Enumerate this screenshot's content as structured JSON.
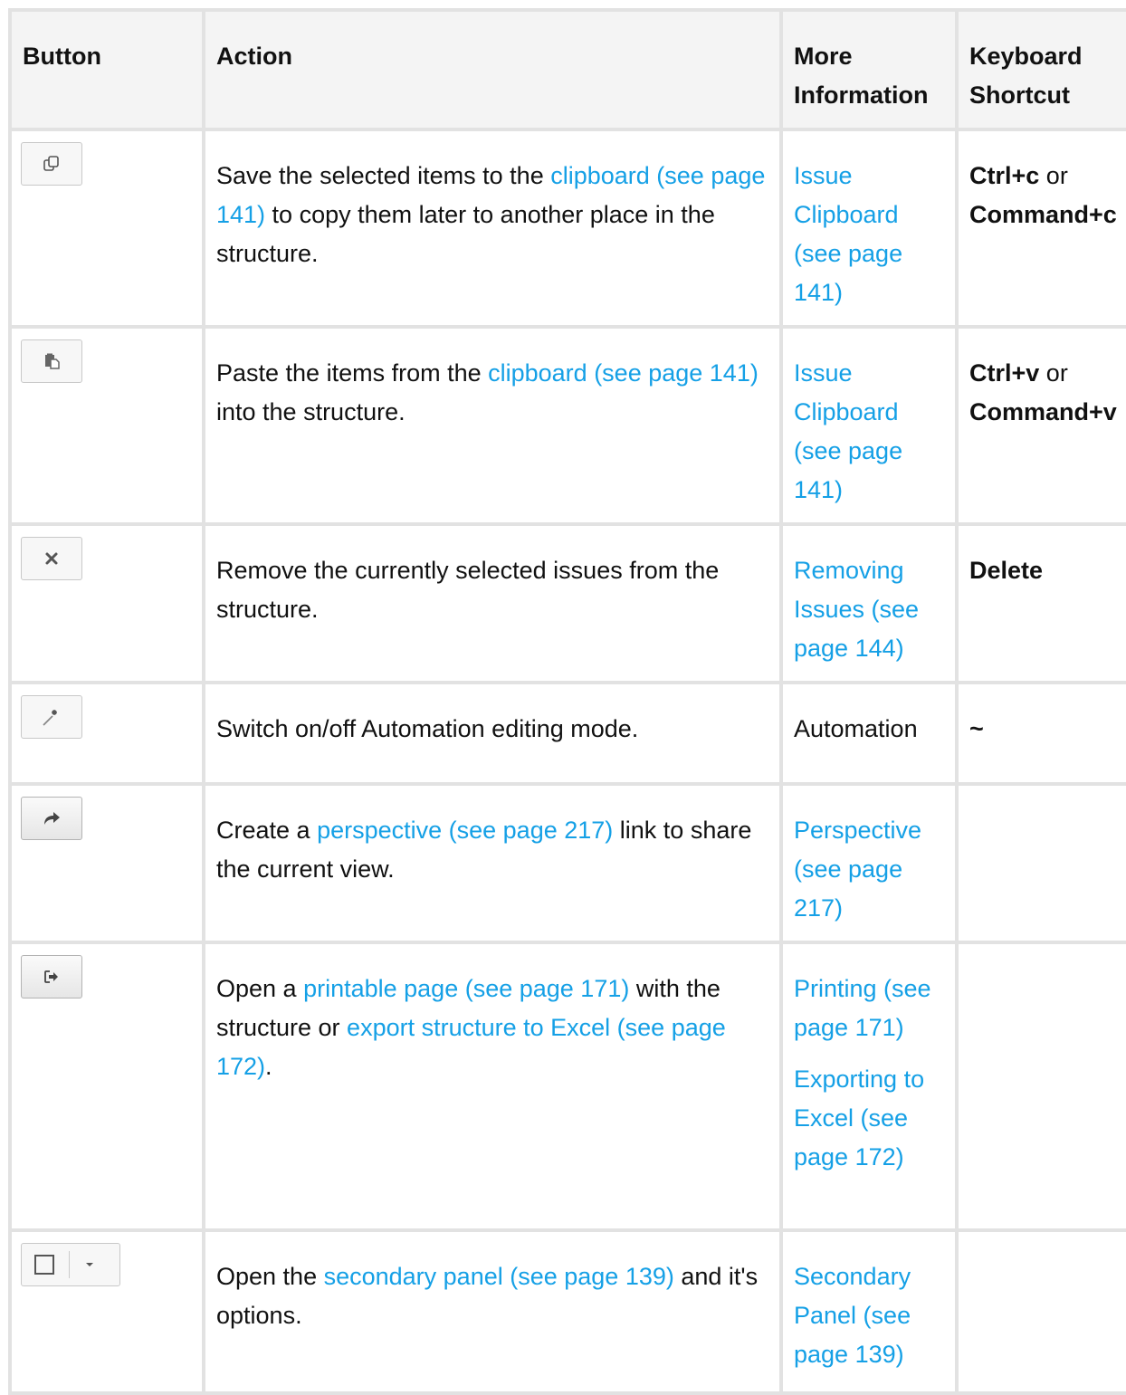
{
  "headers": {
    "button": "Button",
    "action": "Action",
    "more": "More Information",
    "shortcut_line1": "Keyboard",
    "shortcut_line2": "Shortcut"
  },
  "rows": [
    {
      "icon": "copy-icon",
      "action": {
        "pre": "Save the selected items to the ",
        "link": "clipboard (see page 141)",
        "post": " to copy them later to another place in the structure."
      },
      "more": [
        "Issue Clipboard (see page 141)"
      ],
      "shortcut": {
        "k1": "Ctrl+c",
        "or": " or ",
        "k2": "Command+c"
      }
    },
    {
      "icon": "paste-icon",
      "action": {
        "pre": "Paste the items from the ",
        "link": "clipboard (see page 141)",
        "post": " into the structure."
      },
      "more": [
        "Issue Clipboard (see page 141)"
      ],
      "shortcut": {
        "k1": "Ctrl+v",
        "or": " or ",
        "k2": "Command+v"
      }
    },
    {
      "icon": "remove-icon",
      "action": {
        "text": "Remove the currently selected issues from the structure."
      },
      "more": [
        "Removing Issues (see page 144)"
      ],
      "shortcut": {
        "k1": "Delete"
      }
    },
    {
      "icon": "magic-wand-icon",
      "action": {
        "text": "Switch on/off Automation editing mode."
      },
      "more_plain": "Automation",
      "shortcut": {
        "k1": "~"
      }
    },
    {
      "icon": "share-icon",
      "action": {
        "pre": "Create a ",
        "link": "perspective (see page 217)",
        "post": " link to share the current view."
      },
      "more": [
        "Perspective (see page 217)"
      ]
    },
    {
      "icon": "export-icon",
      "action": {
        "pre": "Open a ",
        "link": "printable page (see page 171)",
        "mid": " with the structure or ",
        "link2": "export structure to Excel (see page 172)",
        "post": "."
      },
      "more": [
        "Printing (see page 171)",
        "Exporting to Excel (see page 172)"
      ]
    },
    {
      "icon": "panel-toggle-icon",
      "action": {
        "pre": "Open the ",
        "link": "secondary panel (see page 139)",
        "post": " and it's options."
      },
      "more": [
        "Secondary Panel (see page 139)"
      ]
    }
  ]
}
